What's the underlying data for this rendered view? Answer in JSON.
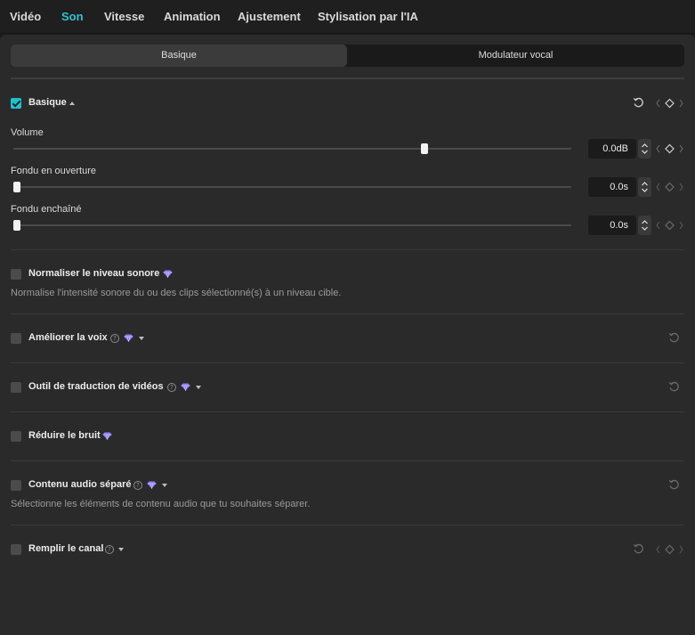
{
  "tabs": [
    "Vidéo",
    "Son",
    "Vitesse",
    "Animation",
    "Ajustement",
    "Stylisation par l'IA"
  ],
  "active_tab": "Son",
  "segments": [
    "Basique",
    "Modulateur vocal"
  ],
  "active_segment": "Basique",
  "accent_color": "#2ec4d0",
  "premium_color": "#8f7cff",
  "basic": {
    "label": "Basique",
    "checked": true,
    "volume": {
      "label": "Volume",
      "value": "0.0dB",
      "level_fraction": 0.74
    },
    "fade_in": {
      "label": "Fondu en ouverture",
      "value": "0.0s",
      "level_fraction": 0.0
    },
    "fade_out": {
      "label": "Fondu enchaîné",
      "value": "0.0s",
      "level_fraction": 0.0
    }
  },
  "sections": {
    "normalize": {
      "label": "Normaliser le niveau sonore",
      "description": "Normalise l'intensité sonore du ou des clips sélectionné(s) à un niveau cible.",
      "icons": [
        "premium-gem-icon"
      ]
    },
    "enhance_voice": {
      "label": "Améliorer la voix",
      "icons": [
        "help-icon",
        "premium-gem-icon",
        "chevron-down-icon",
        "reset-icon"
      ]
    },
    "translate": {
      "label": "Outil de traduction de vidéos",
      "icons": [
        "help-icon",
        "premium-gem-icon",
        "chevron-down-icon",
        "reset-icon"
      ]
    },
    "noise": {
      "label": "Réduire le bruit",
      "icons": [
        "premium-gem-icon"
      ]
    },
    "separate": {
      "label": "Contenu audio séparé",
      "description": "Sélectionne les éléments de contenu audio que tu souhaites séparer.",
      "icons": [
        "help-icon",
        "premium-gem-icon",
        "chevron-down-icon",
        "reset-icon"
      ]
    },
    "fill": {
      "label": "Remplir le canal",
      "icons": [
        "help-icon",
        "chevron-down-icon",
        "reset-icon",
        "keyframe-icon"
      ]
    }
  }
}
